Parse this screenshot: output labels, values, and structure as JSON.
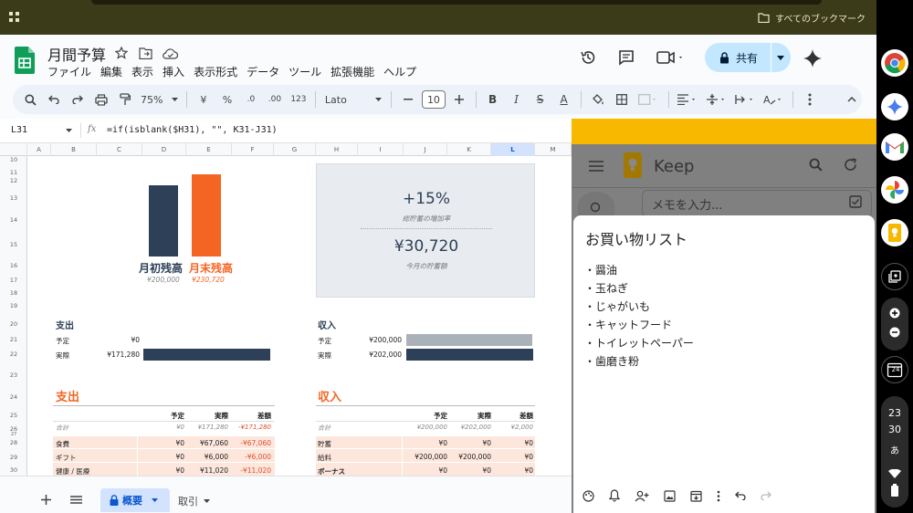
{
  "browser": {
    "bookmarks_label": "すべてのブックマーク"
  },
  "sheets": {
    "title": "月間予算",
    "menu": [
      "ファイル",
      "編集",
      "表示",
      "挿入",
      "表示形式",
      "データ",
      "ツール",
      "拡張機能",
      "ヘルプ"
    ],
    "share_label": "共有",
    "toolbar": {
      "zoom": "75%",
      "currency": "¥",
      "percent": "%",
      "dec_less": ".0",
      "dec_more": ".00",
      "format_123": "123",
      "font": "Lato",
      "font_size": "10"
    },
    "name_box": "L31",
    "formula": "=if(isblank($H31), \"\", K31-J31)",
    "columns": [
      "A",
      "B",
      "C",
      "D",
      "E",
      "F",
      "G",
      "H",
      "I",
      "J",
      "K",
      "L",
      "M"
    ],
    "rows": [
      "10",
      "11",
      "12",
      "13",
      "14",
      "15",
      "16",
      "17",
      "18",
      "19",
      "20",
      "21",
      "22",
      "23",
      "24",
      "25",
      "26",
      "27",
      "28",
      "29",
      "30"
    ],
    "sheet_tabs": [
      "概要",
      "取引"
    ]
  },
  "summary": {
    "start_label": "月初残高",
    "start_value": "¥200,000",
    "end_label": "月末残高",
    "end_value": "¥230,720",
    "savings_pct": "+15%",
    "savings_pct_label": "総貯蓄の増加率",
    "savings_amount": "¥30,720",
    "savings_amount_label": "今月の貯蓄額",
    "bar_colors": {
      "start": "#2d4058",
      "end": "#f46524"
    }
  },
  "expense_mini": {
    "title": "支出",
    "planned_label": "予定",
    "planned_value": "¥0",
    "actual_label": "実際",
    "actual_value": "¥171,280",
    "planned_fraction": 0,
    "actual_fraction": 1
  },
  "income_mini": {
    "title": "収入",
    "planned_label": "予定",
    "planned_value": "¥200,000",
    "actual_label": "実際",
    "actual_value": "¥202,000",
    "planned_fraction": 0.99,
    "actual_fraction": 1
  },
  "expense_table": {
    "title": "支出",
    "headers": [
      "予定",
      "実際",
      "差額"
    ],
    "total": {
      "label": "合計",
      "planned": "¥0",
      "actual": "¥171,280",
      "diff": "-¥171,280"
    },
    "rows": [
      {
        "label": "食費",
        "planned": "¥0",
        "actual": "¥67,060",
        "diff": "-¥67,060"
      },
      {
        "label": "ギフト",
        "planned": "¥0",
        "actual": "¥6,000",
        "diff": "-¥6,000"
      },
      {
        "label": "健康 / 医療",
        "planned": "¥0",
        "actual": "¥11,020",
        "diff": "-¥11,020"
      }
    ]
  },
  "income_table": {
    "title": "収入",
    "headers": [
      "予定",
      "実際",
      "差額"
    ],
    "total": {
      "label": "合計",
      "planned": "¥200,000",
      "actual": "¥202,000",
      "diff": "¥2,000"
    },
    "rows": [
      {
        "label": "貯蓄",
        "planned": "¥0",
        "actual": "¥0",
        "diff": "¥0"
      },
      {
        "label": "給料",
        "planned": "¥200,000",
        "actual": "¥200,000",
        "diff": "¥0"
      },
      {
        "label": "ボーナス",
        "planned": "¥0",
        "actual": "¥0",
        "diff": "¥0"
      }
    ]
  },
  "keep": {
    "app_name": "Keep",
    "take_note_placeholder": "メモを入力...",
    "note_title": "お買い物リスト",
    "note_items": [
      "・醤油",
      "・玉ねぎ",
      "・じゃがいも",
      "・キャットフード",
      "・トイレットペーパー",
      "・歯磨き粉"
    ]
  },
  "shelf": {
    "date_badge": "24",
    "time_hour": "23",
    "time_minute": "30",
    "ime": "あ"
  }
}
